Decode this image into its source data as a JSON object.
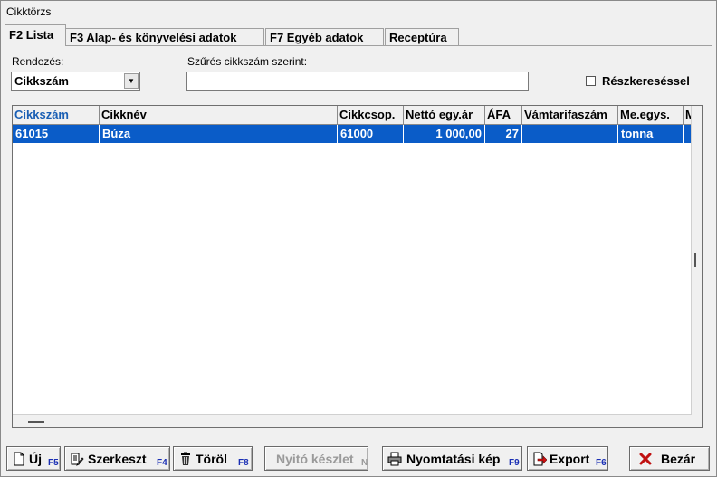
{
  "window": {
    "title": "Cikktörzs"
  },
  "tabs": [
    {
      "label": "F2 Lista",
      "active": true
    },
    {
      "label": "F3 Alap- és könyvelési adatok",
      "active": false
    },
    {
      "label": "F7 Egyéb adatok",
      "active": false
    },
    {
      "label": "Receptúra",
      "active": false
    }
  ],
  "sort": {
    "label": "Rendezés:",
    "value": "Cikkszám"
  },
  "filter": {
    "label": "Szűrés cikkszám szerint:",
    "value": ""
  },
  "partial_search": {
    "label": "Részkereséssel",
    "checked": false
  },
  "table": {
    "columns": [
      "Cikkszám",
      "Cikknév",
      "Cikkcsop.",
      "Nettó egy.ár",
      "ÁFA",
      "Vámtarifaszám",
      "Me.egys.",
      "M"
    ],
    "rows": [
      [
        "61015",
        "Búza",
        "61000",
        "1 000,00",
        "27",
        "",
        "tonna",
        ""
      ]
    ]
  },
  "buttons": {
    "new": {
      "label": "Új",
      "key": "F5"
    },
    "edit": {
      "label": "Szerkeszt",
      "key": "F4"
    },
    "delete": {
      "label": "Töröl",
      "key": "F8"
    },
    "opening_stock": {
      "label": "Nyitó készlet",
      "key": "N"
    },
    "print_preview": {
      "label": "Nyomtatási kép",
      "key": "F9"
    },
    "export": {
      "label": "Export",
      "key": "F6"
    },
    "close": {
      "label": "Bezár"
    }
  },
  "colors": {
    "selection": "#0a5cc8",
    "sorted_header": "#1a5fb4",
    "hotkey": "#1a2fb4",
    "close_x": "#c01010"
  }
}
